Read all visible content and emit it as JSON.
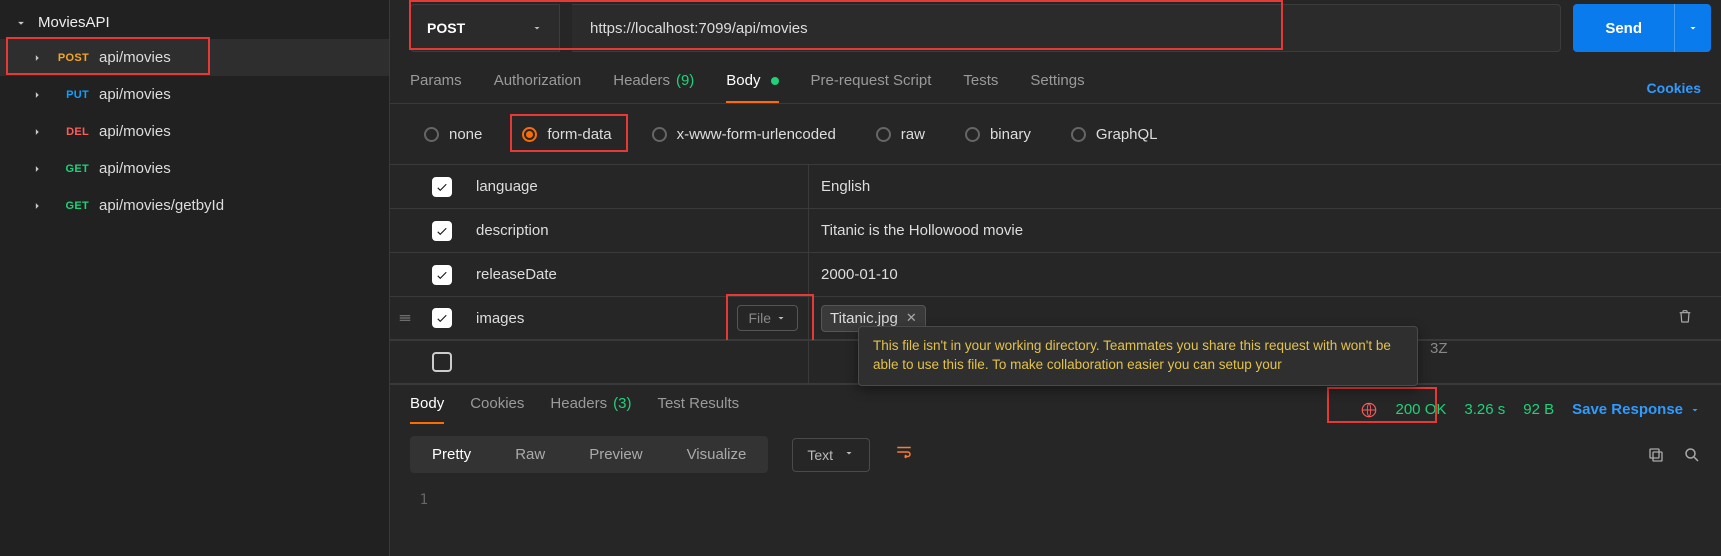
{
  "sidebar": {
    "collection": "MoviesAPI",
    "items": [
      {
        "method": "POST",
        "methodClass": "m-post",
        "path": "api/movies",
        "active": true
      },
      {
        "method": "PUT",
        "methodClass": "m-put",
        "path": "api/movies"
      },
      {
        "method": "DEL",
        "methodClass": "m-del",
        "path": "api/movies"
      },
      {
        "method": "GET",
        "methodClass": "m-get",
        "path": "api/movies"
      },
      {
        "method": "GET",
        "methodClass": "m-get",
        "path": "api/movies/getbyId"
      }
    ]
  },
  "request": {
    "method": "POST",
    "url": "https://localhost:7099/api/movies",
    "sendLabel": "Send"
  },
  "tabs": {
    "params": "Params",
    "auth": "Authorization",
    "headers": "Headers",
    "headersCount": "(9)",
    "body": "Body",
    "prereq": "Pre-request Script",
    "tests": "Tests",
    "settings": "Settings",
    "cookies": "Cookies"
  },
  "bodyTypes": {
    "none": "none",
    "formData": "form-data",
    "xwww": "x-www-form-urlencoded",
    "raw": "raw",
    "binary": "binary",
    "graphql": "GraphQL"
  },
  "formRows": [
    {
      "checked": true,
      "key": "language",
      "value": "English"
    },
    {
      "checked": true,
      "key": "description",
      "value": "Titanic is the Hollowood movie"
    },
    {
      "checked": true,
      "key": "releaseDate",
      "value": "2000-01-10"
    },
    {
      "checked": true,
      "key": "images",
      "fileTypeLabel": "File",
      "fileName": "Titanic.jpg"
    }
  ],
  "warning": "This file isn't in your working directory. Teammates you share this request with won't be able to use this file. To make collaboration easier you can setup your",
  "partialHidden": "3Z",
  "response": {
    "tabs": {
      "body": "Body",
      "cookies": "Cookies",
      "headers": "Headers",
      "headersCount": "(3)",
      "testResults": "Test Results"
    },
    "statusCode": "200 OK",
    "time": "3.26 s",
    "size": "92 B",
    "saveLabel": "Save Response",
    "views": {
      "pretty": "Pretty",
      "raw": "Raw",
      "preview": "Preview",
      "visualize": "Visualize"
    },
    "format": "Text",
    "lineNum": "1"
  },
  "highlights": {
    "sidebarItem": true,
    "urlBar": true,
    "formData": true,
    "fileDropdown": true,
    "status": true
  }
}
